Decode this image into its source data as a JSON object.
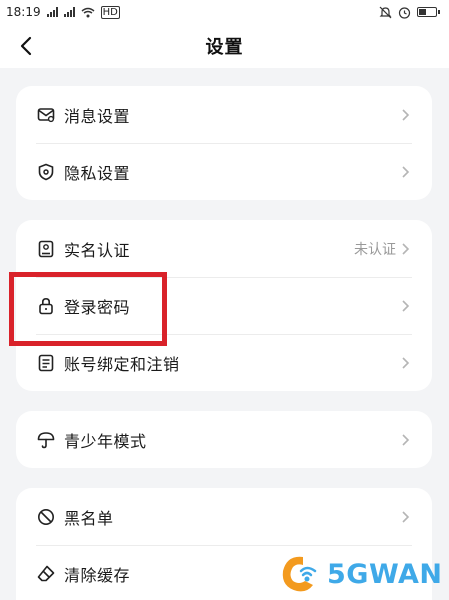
{
  "status_bar": {
    "time": "18:19",
    "network": "HD"
  },
  "header": {
    "title": "设置"
  },
  "groups": [
    {
      "items": [
        {
          "label": "消息设置",
          "icon": "message-settings-icon"
        },
        {
          "label": "隐私设置",
          "icon": "privacy-shield-icon"
        }
      ]
    },
    {
      "items": [
        {
          "label": "实名认证",
          "value": "未认证",
          "icon": "id-card-icon"
        },
        {
          "label": "登录密码",
          "icon": "lock-icon"
        },
        {
          "label": "账号绑定和注销",
          "icon": "document-icon"
        }
      ]
    },
    {
      "items": [
        {
          "label": "青少年模式",
          "icon": "umbrella-icon"
        }
      ]
    },
    {
      "items": [
        {
          "label": "黑名单",
          "icon": "block-icon"
        },
        {
          "label": "清除缓存",
          "icon": "eraser-icon"
        }
      ]
    }
  ],
  "watermark": {
    "text": "5GWAN"
  },
  "colors": {
    "highlight": "#d9222a",
    "background": "#f3f4f6",
    "card": "#ffffff",
    "watermark_blue": "#3fa9e8",
    "watermark_orange": "#f39a1e"
  }
}
